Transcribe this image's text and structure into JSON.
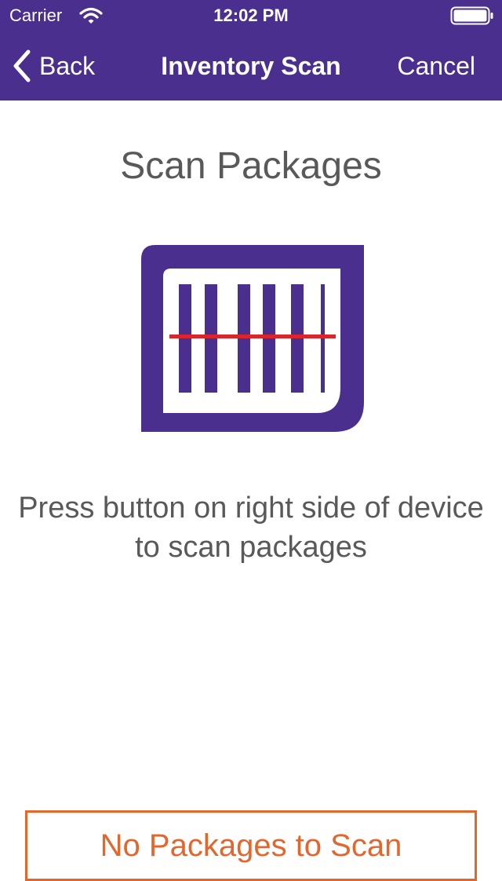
{
  "status_bar": {
    "carrier": "Carrier",
    "time": "12:02 PM",
    "wifi_icon": "wifi-icon",
    "battery_icon": "battery-icon"
  },
  "nav": {
    "back_label": "Back",
    "title": "Inventory Scan",
    "cancel_label": "Cancel",
    "back_icon": "chevron-left-icon"
  },
  "main": {
    "heading": "Scan Packages",
    "illustration_icon": "barcode-scanner-icon",
    "instructions": "Press button on right side of device to scan packages",
    "no_packages_label": "No Packages to Scan"
  },
  "colors": {
    "brand_purple": "#4a2f8e",
    "scan_line_red": "#d9262b",
    "accent_orange": "#e3672d",
    "text_gray": "#595959"
  }
}
